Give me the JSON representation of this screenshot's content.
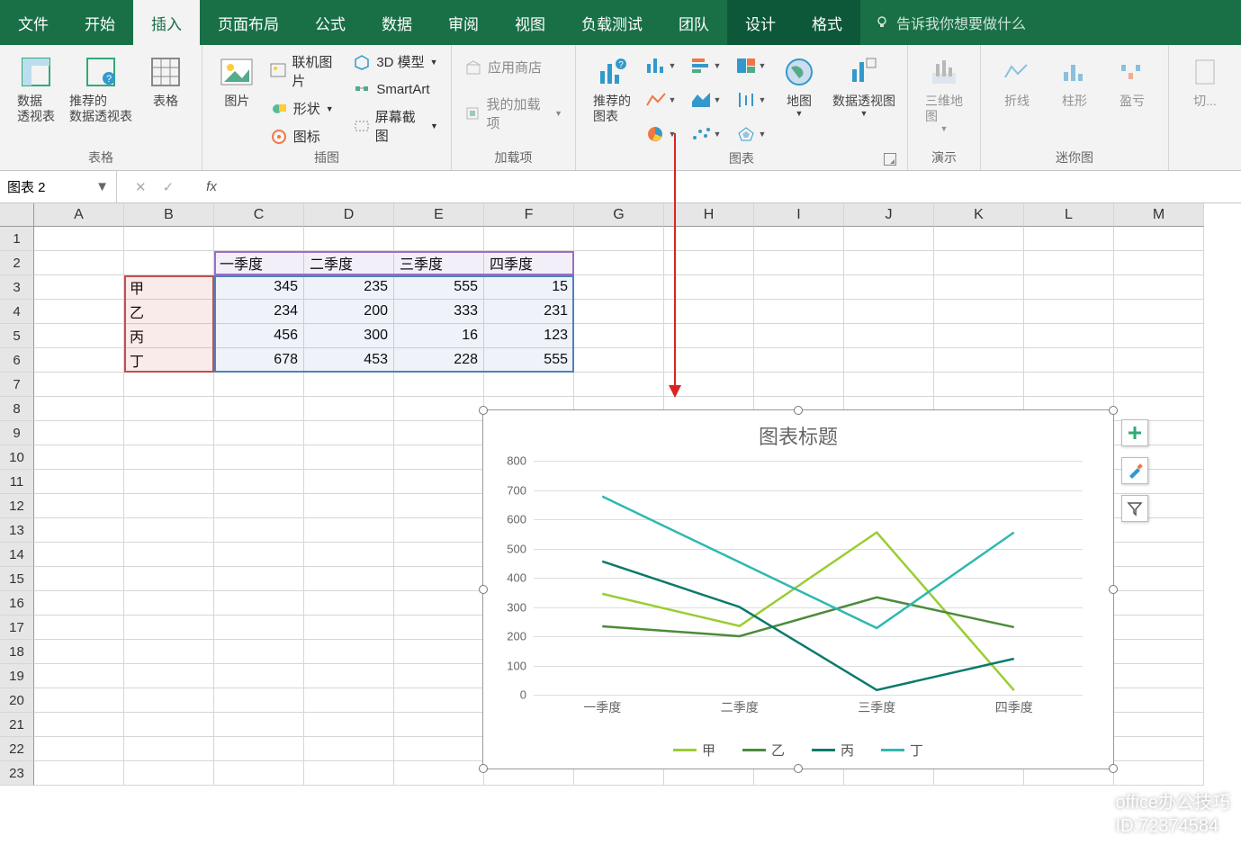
{
  "tabs": [
    "文件",
    "开始",
    "插入",
    "页面布局",
    "公式",
    "数据",
    "审阅",
    "视图",
    "负载测试",
    "团队",
    "设计",
    "格式"
  ],
  "activeTab": "插入",
  "darkTabs": [
    "设计",
    "格式"
  ],
  "tellMe": "告诉我你想要做什么",
  "ribbon": {
    "g1_label": "表格",
    "pivot": "数据\n透视表",
    "recPivot": "推荐的\n数据透视表",
    "table": "表格",
    "g2_label": "插图",
    "picture": "图片",
    "olPic": "联机图片",
    "shapes": "形状",
    "icons": "图标",
    "model3d": "3D 模型",
    "smartart": "SmartArt",
    "screenshot": "屏幕截图",
    "g3_label": "加载项",
    "store": "应用商店",
    "myaddins": "我的加载项",
    "g4_label": "图表",
    "recChart": "推荐的\n图表",
    "map": "地图",
    "pivotChart": "数据透视图",
    "g5_label": "演示",
    "tours": "三维地\n图",
    "g6_label": "迷你图",
    "sparkline": "折线",
    "sparkcol": "柱形",
    "sparkwl": "盈亏",
    "slicer": "切..."
  },
  "nameBox": "图表 2",
  "columns": [
    "A",
    "B",
    "C",
    "D",
    "E",
    "F",
    "G",
    "H",
    "I",
    "J",
    "K",
    "L",
    "M"
  ],
  "rows": [
    "1",
    "2",
    "3",
    "4",
    "5",
    "6",
    "7",
    "8",
    "9",
    "10",
    "11",
    "12",
    "13",
    "14",
    "15",
    "16",
    "17",
    "18",
    "19",
    "20",
    "21",
    "22",
    "23"
  ],
  "table": {
    "headers": [
      "一季度",
      "二季度",
      "三季度",
      "四季度"
    ],
    "rowLabels": [
      "甲",
      "乙",
      "丙",
      "丁"
    ],
    "data": [
      [
        345,
        235,
        555,
        15
      ],
      [
        234,
        200,
        333,
        231
      ],
      [
        456,
        300,
        16,
        123
      ],
      [
        678,
        453,
        228,
        555
      ]
    ]
  },
  "chart": {
    "title": "图表标题",
    "yticks": [
      0,
      100,
      200,
      300,
      400,
      500,
      600,
      700,
      800
    ]
  },
  "chart_data": {
    "type": "line",
    "title": "图表标题",
    "categories": [
      "一季度",
      "二季度",
      "三季度",
      "四季度"
    ],
    "series": [
      {
        "name": "甲",
        "color": "#9acd32",
        "values": [
          345,
          235,
          555,
          15
        ]
      },
      {
        "name": "乙",
        "color": "#4b8b3b",
        "values": [
          234,
          200,
          333,
          231
        ]
      },
      {
        "name": "丙",
        "color": "#0b7a6b",
        "values": [
          456,
          300,
          16,
          123
        ]
      },
      {
        "name": "丁",
        "color": "#2fb8b0",
        "values": [
          678,
          453,
          228,
          555
        ]
      }
    ],
    "ylim": [
      0,
      800
    ],
    "xlabel": "",
    "ylabel": ""
  },
  "watermark": {
    "l1": "office办公技巧",
    "l2": "ID:72374584"
  }
}
